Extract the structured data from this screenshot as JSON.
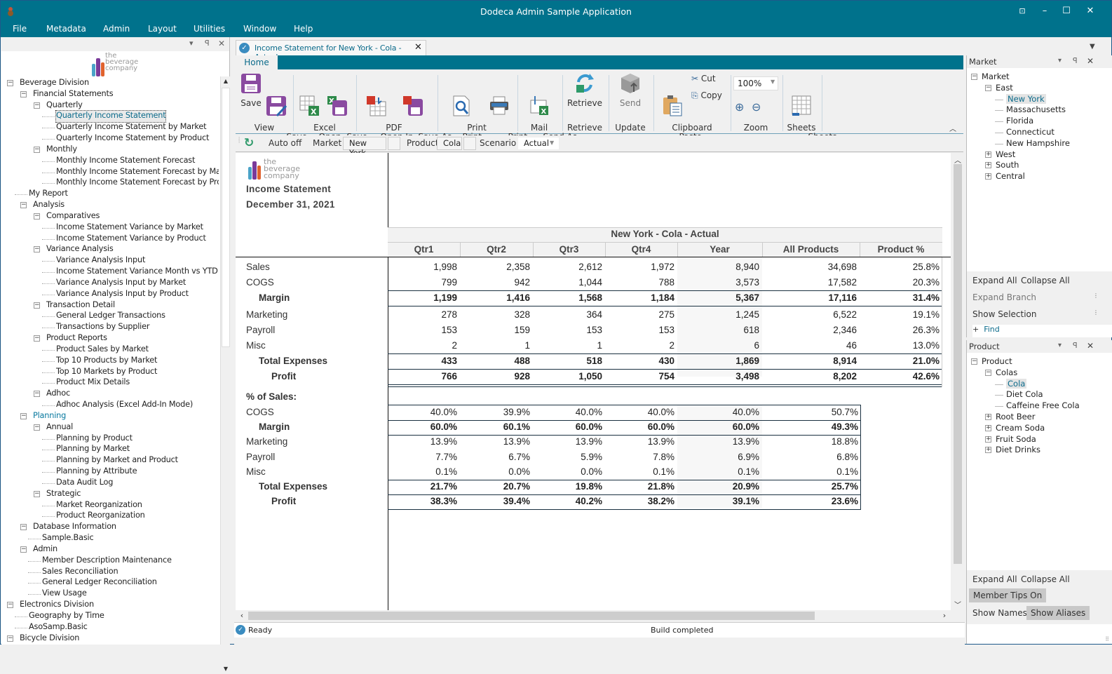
{
  "window": {
    "title": "Dodeca Admin Sample Application"
  },
  "menu": [
    "File",
    "Metadata",
    "Admin",
    "Layout",
    "Utilities",
    "Window",
    "Help"
  ],
  "left_tree": [
    {
      "label": "Beverage Division",
      "level": 0,
      "expander": "minus"
    },
    {
      "label": "Financial Statements",
      "level": 1,
      "expander": "minus"
    },
    {
      "label": "Quarterly",
      "level": 2,
      "expander": "minus"
    },
    {
      "label": "Quarterly Income Statement",
      "level": 3,
      "selected": true
    },
    {
      "label": "Quarterly Income Statement by Market",
      "level": 3
    },
    {
      "label": "Quarterly Income Statement by Product",
      "level": 3
    },
    {
      "label": "Monthly",
      "level": 2,
      "expander": "minus"
    },
    {
      "label": "Monthly Income Statement Forecast",
      "level": 3
    },
    {
      "label": "Monthly Income Statement Forecast by Market",
      "level": 3
    },
    {
      "label": "Monthly Income Statement Forecast by Product",
      "level": 3
    },
    {
      "label": "My Report",
      "level": 1
    },
    {
      "label": "Analysis",
      "level": 1,
      "expander": "minus"
    },
    {
      "label": "Comparatives",
      "level": 2,
      "expander": "minus"
    },
    {
      "label": "Income Statement Variance by Market",
      "level": 3
    },
    {
      "label": "Income Statement Variance by Product",
      "level": 3
    },
    {
      "label": "Variance Analysis",
      "level": 2,
      "expander": "minus"
    },
    {
      "label": "Variance Analysis Input",
      "level": 3
    },
    {
      "label": "Income Statement Variance Month vs YTD",
      "level": 3
    },
    {
      "label": "Variance Analysis Input by Market",
      "level": 3
    },
    {
      "label": "Variance Analysis Input by Product",
      "level": 3
    },
    {
      "label": "Transaction Detail",
      "level": 2,
      "expander": "minus"
    },
    {
      "label": "General Ledger Transactions",
      "level": 3
    },
    {
      "label": "Transactions by Supplier",
      "level": 3
    },
    {
      "label": "Product Reports",
      "level": 2,
      "expander": "minus"
    },
    {
      "label": "Product Sales by Market",
      "level": 3
    },
    {
      "label": "Top 10 Products by Market",
      "level": 3
    },
    {
      "label": "Top 10 Markets by Product",
      "level": 3
    },
    {
      "label": "Product Mix Details",
      "level": 3
    },
    {
      "label": "Adhoc",
      "level": 2,
      "expander": "minus"
    },
    {
      "label": "Adhoc Analysis (Excel Add-In Mode)",
      "level": 3
    },
    {
      "label": "Planning",
      "level": 1,
      "expander": "minus",
      "accent": true
    },
    {
      "label": "Annual",
      "level": 2,
      "expander": "minus"
    },
    {
      "label": "Planning by Product",
      "level": 3
    },
    {
      "label": "Planning by Market",
      "level": 3
    },
    {
      "label": "Planning by Market and Product",
      "level": 3
    },
    {
      "label": "Planning by Attribute",
      "level": 3
    },
    {
      "label": "Data Audit Log",
      "level": 3
    },
    {
      "label": "Strategic",
      "level": 2,
      "expander": "minus"
    },
    {
      "label": "Market Reorganization",
      "level": 3
    },
    {
      "label": "Product Reorganization",
      "level": 3
    },
    {
      "label": "Database Information",
      "level": 1,
      "expander": "minus"
    },
    {
      "label": "Sample.Basic",
      "level": 2
    },
    {
      "label": "Admin",
      "level": 1,
      "expander": "minus"
    },
    {
      "label": "Member Description Maintenance",
      "level": 2
    },
    {
      "label": "Sales Reconciliation",
      "level": 2
    },
    {
      "label": "General Ledger Reconciliation",
      "level": 2
    },
    {
      "label": "View Usage",
      "level": 2
    },
    {
      "label": "Electronics Division",
      "level": 0,
      "expander": "minus"
    },
    {
      "label": "Geography by Time",
      "level": 1
    },
    {
      "label": "AsoSamp.Basic",
      "level": 1
    },
    {
      "label": "Bicycle Division",
      "level": 0,
      "expander": "minus"
    }
  ],
  "logo": {
    "line1": "the",
    "line2": "beverage",
    "line3": "company"
  },
  "doc_tab": {
    "title": "Income Statement for New York - Cola - Actual"
  },
  "ribbon": {
    "tab": "Home",
    "buttons": {
      "save": "Save",
      "save_as": "Save\nAs",
      "open_in": "Open\nIn",
      "excel_save_as": "Save\nAs",
      "open_in_local": "Open In\nLocal",
      "save_as_pdf": "Save As\nPDF",
      "print_preview": "Print\nPreview ▾",
      "print": "Print\n▾",
      "send_as_excel": "Send As\nExcel",
      "retrieve": "Retrieve",
      "send": "Send",
      "paste": "Paste\n▾",
      "cut": "Cut",
      "copy": "Copy",
      "zoom_value": "100%",
      "sheets": "Sheets\n▾"
    },
    "groups": [
      "View",
      "Excel",
      "PDF",
      "Print",
      "Mail",
      "Retrieve",
      "Update",
      "Clipboard",
      "Zoom",
      "Sheets"
    ]
  },
  "pov": {
    "auto": "Auto off",
    "market_label": "Market",
    "market_value": "New York",
    "product_label": "Product",
    "product_value": "Cola",
    "scenario_label": "Scenario",
    "scenario_value": "Actual"
  },
  "report": {
    "title": "Income Statement",
    "date": "December 31, 2021",
    "header": "New York  -  Cola  -  Actual",
    "columns": [
      "Qtr1",
      "Qtr2",
      "Qtr3",
      "Qtr4",
      "Year",
      "All Products",
      "Product %"
    ],
    "rows": [
      {
        "label": "Sales",
        "values": [
          "1,998",
          "2,358",
          "2,612",
          "1,972",
          "8,940",
          "34,698",
          "25.8%"
        ]
      },
      {
        "label": "COGS",
        "values": [
          "799",
          "942",
          "1,044",
          "788",
          "3,573",
          "17,582",
          "20.3%"
        ]
      },
      {
        "label": "Margin",
        "bold": true,
        "indent": 1,
        "values": [
          "1,199",
          "1,416",
          "1,568",
          "1,184",
          "5,367",
          "17,116",
          "31.4%"
        ]
      },
      {
        "label": "Marketing",
        "values": [
          "278",
          "328",
          "364",
          "275",
          "1,245",
          "6,522",
          "19.1%"
        ]
      },
      {
        "label": "Payroll",
        "values": [
          "153",
          "159",
          "153",
          "153",
          "618",
          "2,346",
          "26.3%"
        ]
      },
      {
        "label": "Misc",
        "values": [
          "2",
          "1",
          "1",
          "2",
          "6",
          "46",
          "13.0%"
        ]
      },
      {
        "label": "Total Expenses",
        "bold": true,
        "indent": 1,
        "values": [
          "433",
          "488",
          "518",
          "430",
          "1,869",
          "8,914",
          "21.0%"
        ]
      },
      {
        "label": "Profit",
        "bold": true,
        "indent": 2,
        "values": [
          "766",
          "928",
          "1,050",
          "754",
          "3,498",
          "8,202",
          "42.6%"
        ]
      }
    ],
    "pct_title": "% of Sales:",
    "pct_rows": [
      {
        "label": "COGS",
        "values": [
          "40.0%",
          "39.9%",
          "40.0%",
          "40.0%",
          "40.0%",
          "50.7%"
        ]
      },
      {
        "label": "Margin",
        "bold": true,
        "indent": 1,
        "values": [
          "60.0%",
          "60.1%",
          "60.0%",
          "60.0%",
          "60.0%",
          "49.3%"
        ]
      },
      {
        "label": "Marketing",
        "values": [
          "13.9%",
          "13.9%",
          "13.9%",
          "13.9%",
          "13.9%",
          "18.8%"
        ]
      },
      {
        "label": "Payroll",
        "values": [
          "7.7%",
          "6.7%",
          "5.9%",
          "7.8%",
          "6.9%",
          "6.8%"
        ]
      },
      {
        "label": "Misc",
        "values": [
          "0.1%",
          "0.0%",
          "0.0%",
          "0.1%",
          "0.1%",
          "0.1%"
        ]
      },
      {
        "label": "Total Expenses",
        "bold": true,
        "indent": 1,
        "values": [
          "21.7%",
          "20.7%",
          "19.8%",
          "21.8%",
          "20.9%",
          "25.7%"
        ]
      },
      {
        "label": "Profit",
        "bold": true,
        "indent": 2,
        "values": [
          "38.3%",
          "39.4%",
          "40.2%",
          "38.2%",
          "39.1%",
          "23.6%"
        ]
      }
    ]
  },
  "status": {
    "left": "Ready",
    "center": "Build completed"
  },
  "market_pane": {
    "title": "Market",
    "tree": [
      {
        "label": "Market",
        "level": 0,
        "expander": "minus"
      },
      {
        "label": "East",
        "level": 1,
        "expander": "minus"
      },
      {
        "label": "New York",
        "level": 2,
        "selected": true
      },
      {
        "label": "Massachusetts",
        "level": 2
      },
      {
        "label": "Florida",
        "level": 2
      },
      {
        "label": "Connecticut",
        "level": 2
      },
      {
        "label": "New Hampshire",
        "level": 2
      },
      {
        "label": "West",
        "level": 1,
        "expander": "plus"
      },
      {
        "label": "South",
        "level": 1,
        "expander": "plus"
      },
      {
        "label": "Central",
        "level": 1,
        "expander": "plus"
      }
    ],
    "expand_all": "Expand All",
    "collapse_all": "Collapse All",
    "expand_branch": "Expand Branch",
    "show_selection": "Show Selection",
    "find": "Find"
  },
  "product_pane": {
    "title": "Product",
    "tree": [
      {
        "label": "Product",
        "level": 0,
        "expander": "minus"
      },
      {
        "label": "Colas",
        "level": 1,
        "expander": "minus"
      },
      {
        "label": "Cola",
        "level": 2,
        "selected": true
      },
      {
        "label": "Diet Cola",
        "level": 2
      },
      {
        "label": "Caffeine Free Cola",
        "level": 2
      },
      {
        "label": "Root Beer",
        "level": 1,
        "expander": "plus"
      },
      {
        "label": "Cream Soda",
        "level": 1,
        "expander": "plus"
      },
      {
        "label": "Fruit Soda",
        "level": 1,
        "expander": "plus"
      },
      {
        "label": "Diet Drinks",
        "level": 1,
        "expander": "plus"
      }
    ],
    "expand_all": "Expand All",
    "collapse_all": "Collapse All",
    "member_tips": "Member Tips On",
    "show_names": "Show Names",
    "show_aliases": "Show Aliases"
  }
}
